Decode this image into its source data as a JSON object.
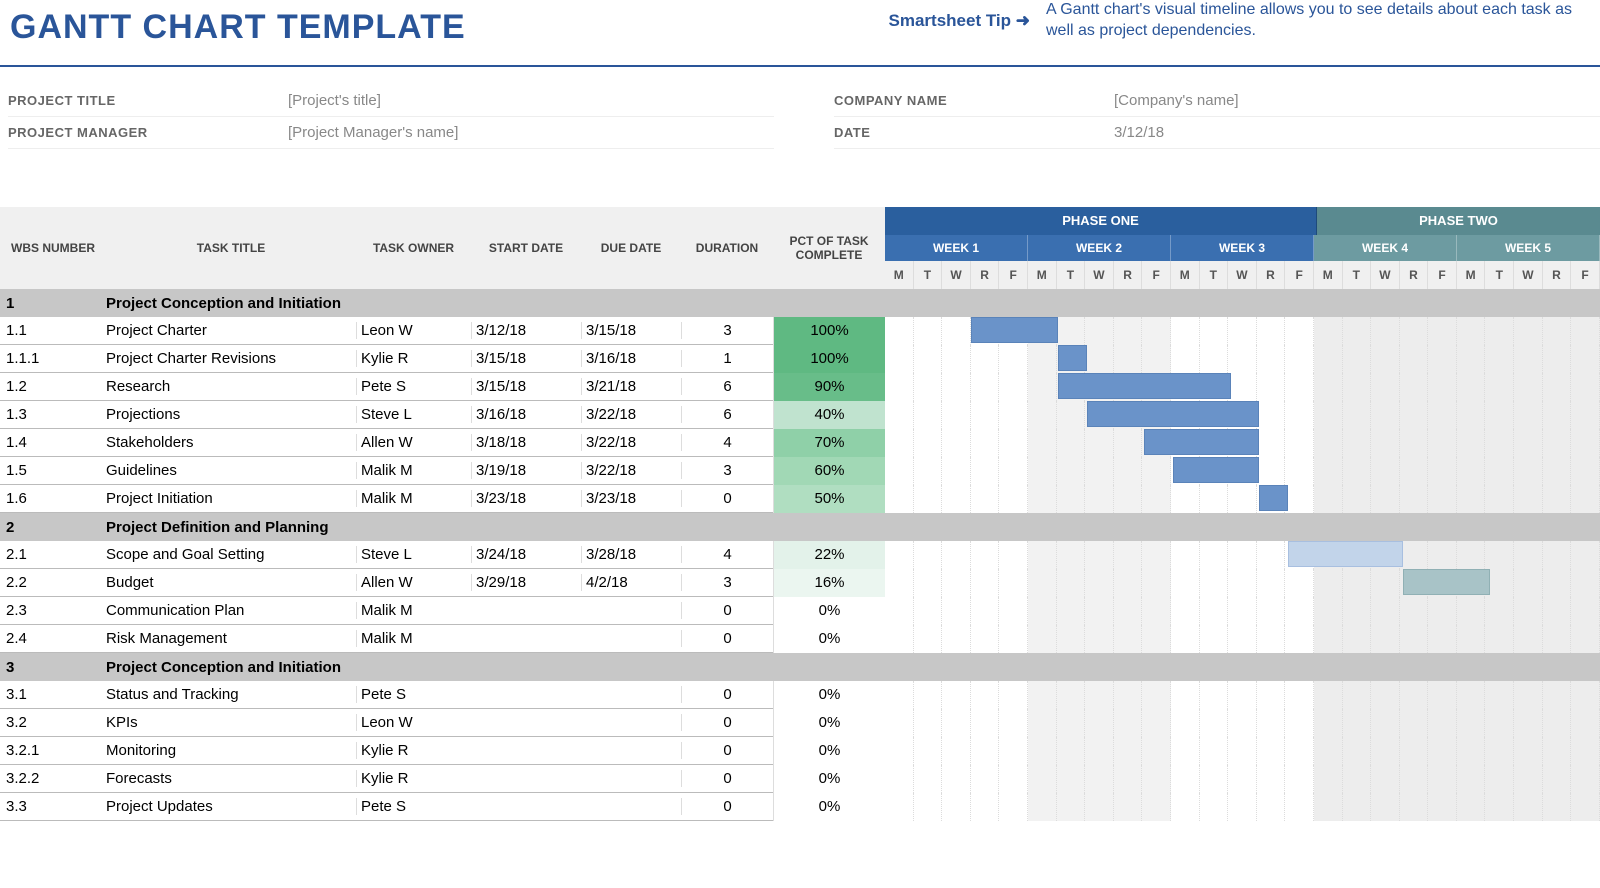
{
  "page_title": "GANTT CHART TEMPLATE",
  "tip_link": "Smartsheet Tip ➜",
  "tip_text": "A Gantt chart's visual timeline allows you to see details about each task as well as project dependencies.",
  "meta": {
    "project_title_label": "PROJECT TITLE",
    "project_title_value": "[Project's title]",
    "project_manager_label": "PROJECT MANAGER",
    "project_manager_value": "[Project Manager's name]",
    "company_name_label": "COMPANY NAME",
    "company_name_value": "[Company's name]",
    "date_label": "DATE",
    "date_value": "3/12/18"
  },
  "headers": {
    "wbs": "WBS NUMBER",
    "title": "TASK TITLE",
    "owner": "TASK OWNER",
    "start": "START DATE",
    "due": "DUE DATE",
    "dur": "DURATION",
    "pct": "PCT OF TASK COMPLETE"
  },
  "phases": [
    "PHASE ONE",
    "PHASE TWO"
  ],
  "weeks": [
    "WEEK 1",
    "WEEK 2",
    "WEEK 3",
    "WEEK 4",
    "WEEK 5"
  ],
  "days": [
    "M",
    "T",
    "W",
    "R",
    "F"
  ],
  "rows": [
    {
      "type": "section",
      "wbs": "1",
      "title": "Project Conception and Initiation"
    },
    {
      "type": "task",
      "wbs": "1.1",
      "title": "Project Charter",
      "owner": "Leon W",
      "start": "3/12/18",
      "due": "3/15/18",
      "dur": "3",
      "pct": "100%",
      "pctbg": "#5fb982",
      "bar": [
        3,
        3,
        "solid"
      ]
    },
    {
      "type": "task",
      "wbs": "1.1.1",
      "title": "Project Charter Revisions",
      "owner": "Kylie R",
      "start": "3/15/18",
      "due": "3/16/18",
      "dur": "1",
      "pct": "100%",
      "pctbg": "#5fb982",
      "bar": [
        6,
        1,
        "solid"
      ]
    },
    {
      "type": "task",
      "wbs": "1.2",
      "title": "Research",
      "owner": "Pete S",
      "start": "3/15/18",
      "due": "3/21/18",
      "dur": "6",
      "pct": "90%",
      "pctbg": "#68bd89",
      "bar": [
        6,
        6,
        "solid"
      ]
    },
    {
      "type": "task",
      "wbs": "1.3",
      "title": "Projections",
      "owner": "Steve L",
      "start": "3/16/18",
      "due": "3/22/18",
      "dur": "6",
      "pct": "40%",
      "pctbg": "#c0e3cf",
      "bar": [
        7,
        6,
        "solid"
      ]
    },
    {
      "type": "task",
      "wbs": "1.4",
      "title": "Stakeholders",
      "owner": "Allen W",
      "start": "3/18/18",
      "due": "3/22/18",
      "dur": "4",
      "pct": "70%",
      "pctbg": "#8fd0a8",
      "bar": [
        9,
        4,
        "solid"
      ]
    },
    {
      "type": "task",
      "wbs": "1.5",
      "title": "Guidelines",
      "owner": "Malik M",
      "start": "3/19/18",
      "due": "3/22/18",
      "dur": "3",
      "pct": "60%",
      "pctbg": "#a1d8b5",
      "bar": [
        10,
        3,
        "solid"
      ]
    },
    {
      "type": "task",
      "wbs": "1.6",
      "title": "Project Initiation",
      "owner": "Malik M",
      "start": "3/23/18",
      "due": "3/23/18",
      "dur": "0",
      "pct": "50%",
      "pctbg": "#b0dec1",
      "bar": [
        13,
        1,
        "solid"
      ]
    },
    {
      "type": "section",
      "wbs": "2",
      "title": "Project Definition and Planning"
    },
    {
      "type": "task",
      "wbs": "2.1",
      "title": "Scope and Goal Setting",
      "owner": "Steve L",
      "start": "3/24/18",
      "due": "3/28/18",
      "dur": "4",
      "pct": "22%",
      "pctbg": "#e3f2ea",
      "bar": [
        14,
        4,
        "light"
      ]
    },
    {
      "type": "task",
      "wbs": "2.2",
      "title": "Budget",
      "owner": "Allen W",
      "start": "3/29/18",
      "due": "4/2/18",
      "dur": "3",
      "pct": "16%",
      "pctbg": "#ebf6f0",
      "bar": [
        18,
        3,
        "teal"
      ]
    },
    {
      "type": "task",
      "wbs": "2.3",
      "title": "Communication Plan",
      "owner": "Malik M",
      "start": "",
      "due": "",
      "dur": "0",
      "pct": "0%",
      "pctbg": "#ffffff"
    },
    {
      "type": "task",
      "wbs": "2.4",
      "title": "Risk Management",
      "owner": "Malik M",
      "start": "",
      "due": "",
      "dur": "0",
      "pct": "0%",
      "pctbg": "#ffffff"
    },
    {
      "type": "section",
      "wbs": "3",
      "title": "Project Conception and Initiation"
    },
    {
      "type": "task",
      "wbs": "3.1",
      "title": "Status and Tracking",
      "owner": "Pete S",
      "start": "",
      "due": "",
      "dur": "0",
      "pct": "0%",
      "pctbg": "#ffffff"
    },
    {
      "type": "task",
      "wbs": "3.2",
      "title": "KPIs",
      "owner": "Leon W",
      "start": "",
      "due": "",
      "dur": "0",
      "pct": "0%",
      "pctbg": "#ffffff"
    },
    {
      "type": "task",
      "wbs": "3.2.1",
      "title": "Monitoring",
      "owner": "Kylie R",
      "start": "",
      "due": "",
      "dur": "0",
      "pct": "0%",
      "pctbg": "#ffffff"
    },
    {
      "type": "task",
      "wbs": "3.2.2",
      "title": "Forecasts",
      "owner": "Kylie R",
      "start": "",
      "due": "",
      "dur": "0",
      "pct": "0%",
      "pctbg": "#ffffff"
    },
    {
      "type": "task",
      "wbs": "3.3",
      "title": "Project Updates",
      "owner": "Pete S",
      "start": "",
      "due": "",
      "dur": "0",
      "pct": "0%",
      "pctbg": "#ffffff"
    }
  ],
  "chart_data": {
    "type": "gantt",
    "title": "GANTT CHART TEMPLATE",
    "start_date": "3/12/18",
    "weekdays_per_week": 5,
    "phases": [
      {
        "name": "PHASE ONE",
        "weeks": [
          "WEEK 1",
          "WEEK 2",
          "WEEK 3"
        ]
      },
      {
        "name": "PHASE TWO",
        "weeks": [
          "WEEK 4",
          "WEEK 5"
        ]
      }
    ],
    "tasks": [
      {
        "wbs": "1.1",
        "title": "Project Charter",
        "owner": "Leon W",
        "start": "3/12/18",
        "due": "3/15/18",
        "duration": 3,
        "pct_complete": 100,
        "bar_start_day": 3,
        "bar_span": 3
      },
      {
        "wbs": "1.1.1",
        "title": "Project Charter Revisions",
        "owner": "Kylie R",
        "start": "3/15/18",
        "due": "3/16/18",
        "duration": 1,
        "pct_complete": 100,
        "bar_start_day": 6,
        "bar_span": 1
      },
      {
        "wbs": "1.2",
        "title": "Research",
        "owner": "Pete S",
        "start": "3/15/18",
        "due": "3/21/18",
        "duration": 6,
        "pct_complete": 90,
        "bar_start_day": 6,
        "bar_span": 6
      },
      {
        "wbs": "1.3",
        "title": "Projections",
        "owner": "Steve L",
        "start": "3/16/18",
        "due": "3/22/18",
        "duration": 6,
        "pct_complete": 40,
        "bar_start_day": 7,
        "bar_span": 6
      },
      {
        "wbs": "1.4",
        "title": "Stakeholders",
        "owner": "Allen W",
        "start": "3/18/18",
        "due": "3/22/18",
        "duration": 4,
        "pct_complete": 70,
        "bar_start_day": 9,
        "bar_span": 4
      },
      {
        "wbs": "1.5",
        "title": "Guidelines",
        "owner": "Malik M",
        "start": "3/19/18",
        "due": "3/22/18",
        "duration": 3,
        "pct_complete": 60,
        "bar_start_day": 10,
        "bar_span": 3
      },
      {
        "wbs": "1.6",
        "title": "Project Initiation",
        "owner": "Malik M",
        "start": "3/23/18",
        "due": "3/23/18",
        "duration": 0,
        "pct_complete": 50,
        "bar_start_day": 13,
        "bar_span": 1
      },
      {
        "wbs": "2.1",
        "title": "Scope and Goal Setting",
        "owner": "Steve L",
        "start": "3/24/18",
        "due": "3/28/18",
        "duration": 4,
        "pct_complete": 22,
        "bar_start_day": 14,
        "bar_span": 4
      },
      {
        "wbs": "2.2",
        "title": "Budget",
        "owner": "Allen W",
        "start": "3/29/18",
        "due": "4/2/18",
        "duration": 3,
        "pct_complete": 16,
        "bar_start_day": 18,
        "bar_span": 3
      },
      {
        "wbs": "2.3",
        "title": "Communication Plan",
        "owner": "Malik M",
        "start": "",
        "due": "",
        "duration": 0,
        "pct_complete": 0
      },
      {
        "wbs": "2.4",
        "title": "Risk Management",
        "owner": "Malik M",
        "start": "",
        "due": "",
        "duration": 0,
        "pct_complete": 0
      },
      {
        "wbs": "3.1",
        "title": "Status and Tracking",
        "owner": "Pete S",
        "start": "",
        "due": "",
        "duration": 0,
        "pct_complete": 0
      },
      {
        "wbs": "3.2",
        "title": "KPIs",
        "owner": "Leon W",
        "start": "",
        "due": "",
        "duration": 0,
        "pct_complete": 0
      },
      {
        "wbs": "3.2.1",
        "title": "Monitoring",
        "owner": "Kylie R",
        "start": "",
        "due": "",
        "duration": 0,
        "pct_complete": 0
      },
      {
        "wbs": "3.2.2",
        "title": "Forecasts",
        "owner": "Kylie R",
        "start": "",
        "due": "",
        "duration": 0,
        "pct_complete": 0
      },
      {
        "wbs": "3.3",
        "title": "Project Updates",
        "owner": "Pete S",
        "start": "",
        "due": "",
        "duration": 0,
        "pct_complete": 0
      }
    ]
  }
}
